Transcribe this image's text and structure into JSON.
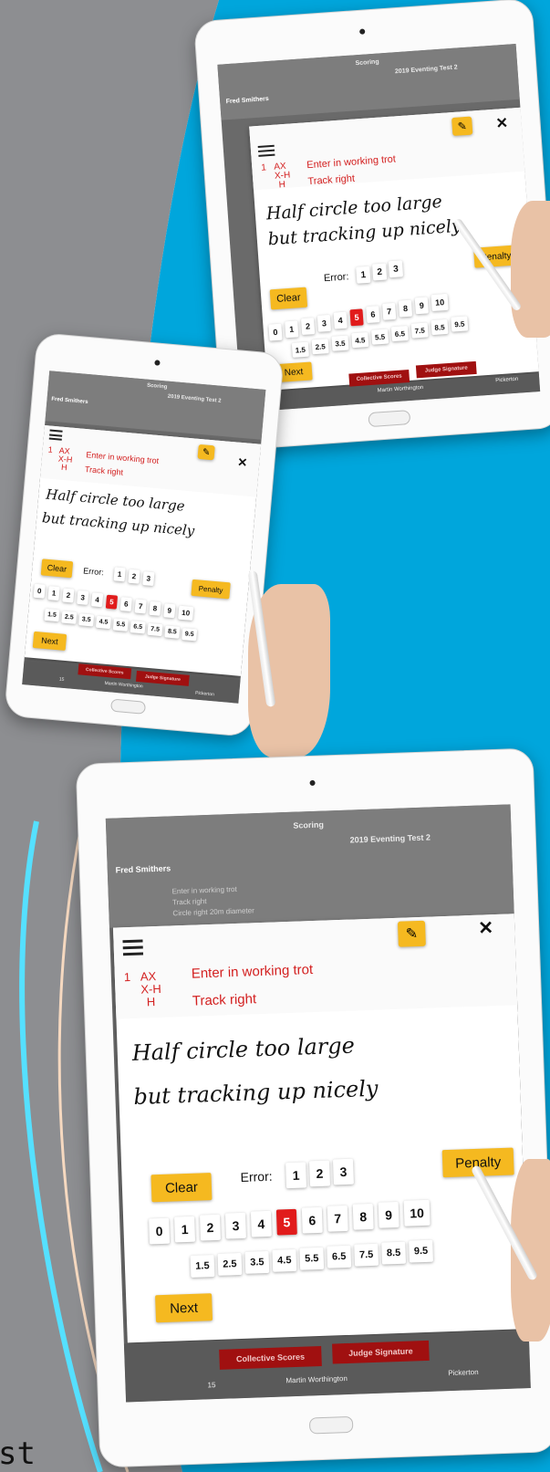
{
  "colors": {
    "accent_yellow": "#f5b920",
    "selected_red": "#e11b1b",
    "text_red": "#d32020",
    "bg_blue": "#00a6dc",
    "bg_gray": "#8d8e91"
  },
  "app": {
    "header_title": "Scoring",
    "test_name": "2019 Eventing Test 2",
    "rider": "Fred Smithers",
    "bg_rows": [
      "Enter in working trot",
      "Track right",
      "Circle right 20m diameter"
    ],
    "bg_markers": "A X\nX H\nH"
  },
  "modal": {
    "movement_number": "1",
    "markers": [
      "AX",
      "X-H",
      "H"
    ],
    "movements": [
      "Enter in working trot",
      "Track right"
    ],
    "handwriting": [
      "Half circle too large",
      "but tracking up nicely"
    ],
    "clear_label": "Clear",
    "error_label": "Error:",
    "error_options": [
      "1",
      "2",
      "3"
    ],
    "penalty_label": "Penalty",
    "score_keys": [
      "0",
      "1",
      "2",
      "3",
      "4",
      "5",
      "6",
      "7",
      "8",
      "9",
      "10"
    ],
    "half_keys": [
      "1.5",
      "2.5",
      "3.5",
      "4.5",
      "5.5",
      "6.5",
      "7.5",
      "8.5",
      "9.5"
    ],
    "selected_score": "5",
    "next_label": "Next",
    "eraser_icon": "eraser-icon",
    "close_icon": "close-icon",
    "menu_icon": "hamburger-menu-icon"
  },
  "footer": {
    "collective_label": "Collective Scores",
    "judge_label": "Judge Signature",
    "count": "15",
    "judge_name": "Martin Worthington",
    "venue": "Pickerton"
  },
  "stray_text": "st"
}
